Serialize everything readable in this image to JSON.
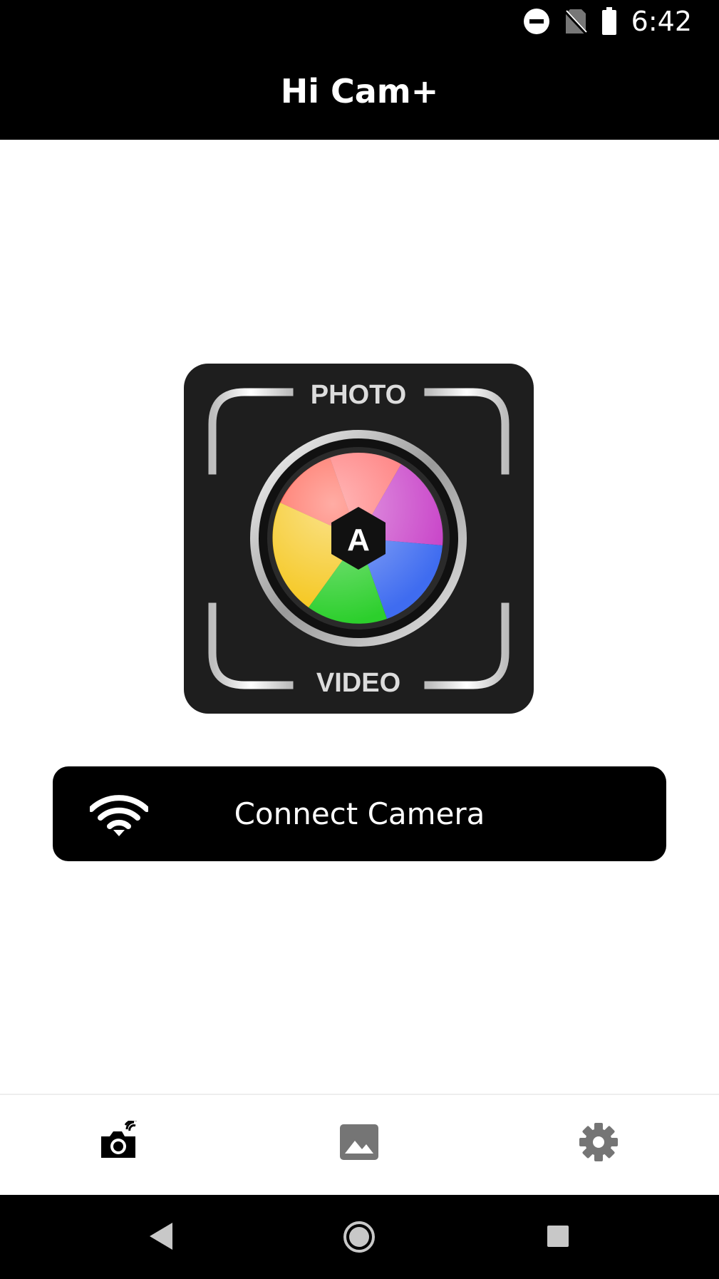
{
  "status_bar": {
    "time": "6:42",
    "icons": [
      "do-not-disturb-icon",
      "no-sim-icon",
      "battery-icon"
    ]
  },
  "app_bar": {
    "title": "Hi Cam+"
  },
  "logo": {
    "top_text": "PHOTO",
    "center_letter": "A",
    "bottom_text": "VIDEO"
  },
  "connect_button": {
    "label": "Connect Camera",
    "icon": "wifi-icon"
  },
  "bottom_nav": {
    "items": [
      {
        "icon": "camera-icon",
        "active": true
      },
      {
        "icon": "gallery-icon",
        "active": false
      },
      {
        "icon": "settings-icon",
        "active": false
      }
    ]
  },
  "system_nav": {
    "buttons": [
      "back-icon",
      "home-icon",
      "recents-icon"
    ]
  },
  "colors": {
    "bar_background": "#000000",
    "button_background": "#000000",
    "nav_active": "#000000",
    "nav_inactive": "#757575"
  }
}
